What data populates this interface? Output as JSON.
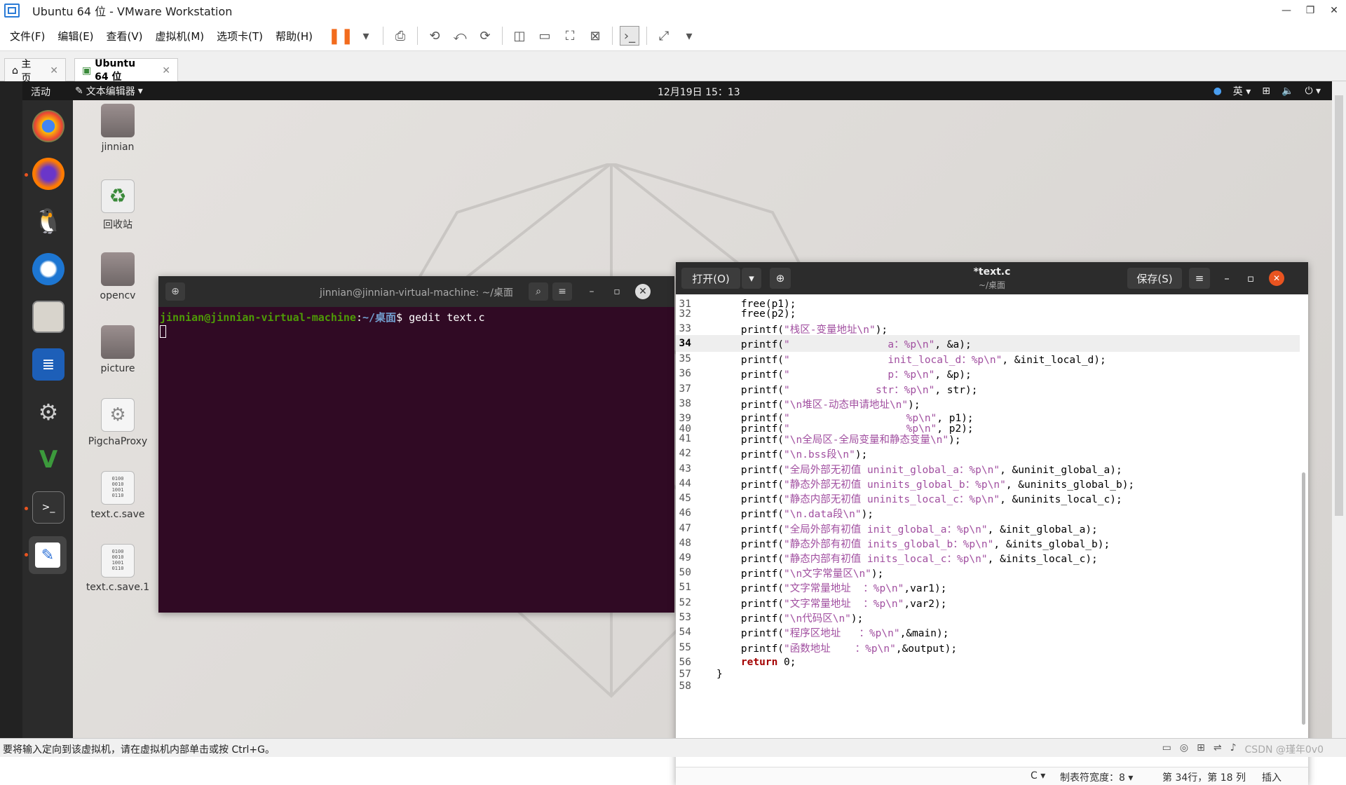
{
  "window_title": "Ubuntu 64 位 - VMware Workstation",
  "menu": [
    "文件(F)",
    "编辑(E)",
    "查看(V)",
    "虚拟机(M)",
    "选项卡(T)",
    "帮助(H)"
  ],
  "tabs": [
    {
      "label": "主页"
    },
    {
      "label": "Ubuntu 64 位"
    }
  ],
  "topbar": {
    "activities": "活动",
    "app": "文本编辑器",
    "clock": "12月19日 15：13",
    "ime": "英"
  },
  "dock": [
    "chrome-icon",
    "firefox-icon",
    "qq-icon",
    "thunderbird-icon",
    "files-icon",
    "writer-icon",
    "settings-icon",
    "vim-icon",
    "terminal-icon",
    "text-editor-icon"
  ],
  "desktop_icons": [
    {
      "label": "jinnian",
      "kind": "home-folder"
    },
    {
      "label": "回收站",
      "kind": "trash"
    },
    {
      "label": "opencv",
      "kind": "folder"
    },
    {
      "label": "picture",
      "kind": "folder"
    },
    {
      "label": "PigchaProxy",
      "kind": "app"
    },
    {
      "label": "text.c.save",
      "kind": "file"
    },
    {
      "label": "text.c.save.1",
      "kind": "file"
    }
  ],
  "terminal": {
    "title": "jinnian@jinnian-virtual-machine: ~/桌面",
    "user": "jinnian@jinnian-virtual-machine",
    "path": "~/桌面",
    "command": "$ gedit text.c"
  },
  "gedit": {
    "open": "打开(O)",
    "save": "保存(S)",
    "title": "*text.c",
    "subtitle": "~/桌面",
    "lines": [
      [
        "31",
        "    free(p1);"
      ],
      [
        "32",
        "    free(p2);"
      ],
      [
        "33",
        "    printf(\"栈区-变量地址\\n\");"
      ],
      [
        "34",
        "    printf(\"                a：%p\\n\", &a);"
      ],
      [
        "35",
        "    printf(\"                init_local_d：%p\\n\", &init_local_d);"
      ],
      [
        "36",
        "    printf(\"                p：%p\\n\", &p);"
      ],
      [
        "37",
        "    printf(\"              str：%p\\n\", str);"
      ],
      [
        "38",
        "    printf(\"\\n堆区-动态申请地址\\n\");"
      ],
      [
        "39",
        "    printf(\"                   %p\\n\", p1);"
      ],
      [
        "40",
        "    printf(\"                   %p\\n\", p2);"
      ],
      [
        "41",
        "    printf(\"\\n全局区-全局变量和静态变量\\n\");"
      ],
      [
        "42",
        "    printf(\"\\n.bss段\\n\");"
      ],
      [
        "43",
        "    printf(\"全局外部无初值 uninit_global_a：%p\\n\", &uninit_global_a);"
      ],
      [
        "44",
        "    printf(\"静态外部无初值 uninits_global_b：%p\\n\", &uninits_global_b);"
      ],
      [
        "45",
        "    printf(\"静态内部无初值 uninits_local_c：%p\\n\", &uninits_local_c);"
      ],
      [
        "46",
        "    printf(\"\\n.data段\\n\");"
      ],
      [
        "47",
        "    printf(\"全局外部有初值 init_global_a：%p\\n\", &init_global_a);"
      ],
      [
        "48",
        "    printf(\"静态外部有初值 inits_global_b：%p\\n\", &inits_global_b);"
      ],
      [
        "49",
        "    printf(\"静态内部有初值 inits_local_c：%p\\n\", &inits_local_c);"
      ],
      [
        "50",
        "    printf(\"\\n文字常量区\\n\");"
      ],
      [
        "51",
        "    printf(\"文字常量地址  ：%p\\n\",var1);"
      ],
      [
        "52",
        "    printf(\"文字常量地址  ：%p\\n\",var2);"
      ],
      [
        "53",
        "    printf(\"\\n代码区\\n\");"
      ],
      [
        "54",
        "    printf(\"程序区地址   ：%p\\n\",&main);"
      ],
      [
        "55",
        "    printf(\"函数地址    ：%p\\n\",&output);"
      ],
      [
        "56",
        "    return 0;"
      ],
      [
        "57",
        "}"
      ],
      [
        "58",
        ""
      ]
    ],
    "status": {
      "lang": "C ▾",
      "tab": "制表符宽度：8 ▾",
      "pos": "第 34行，第 18 列",
      "mode": "插入"
    }
  },
  "vm_status": "要将输入定向到该虚拟机，请在虚拟机内部单击或按 Ctrl+G。",
  "watermark": "CSDN @瑾年0v0"
}
